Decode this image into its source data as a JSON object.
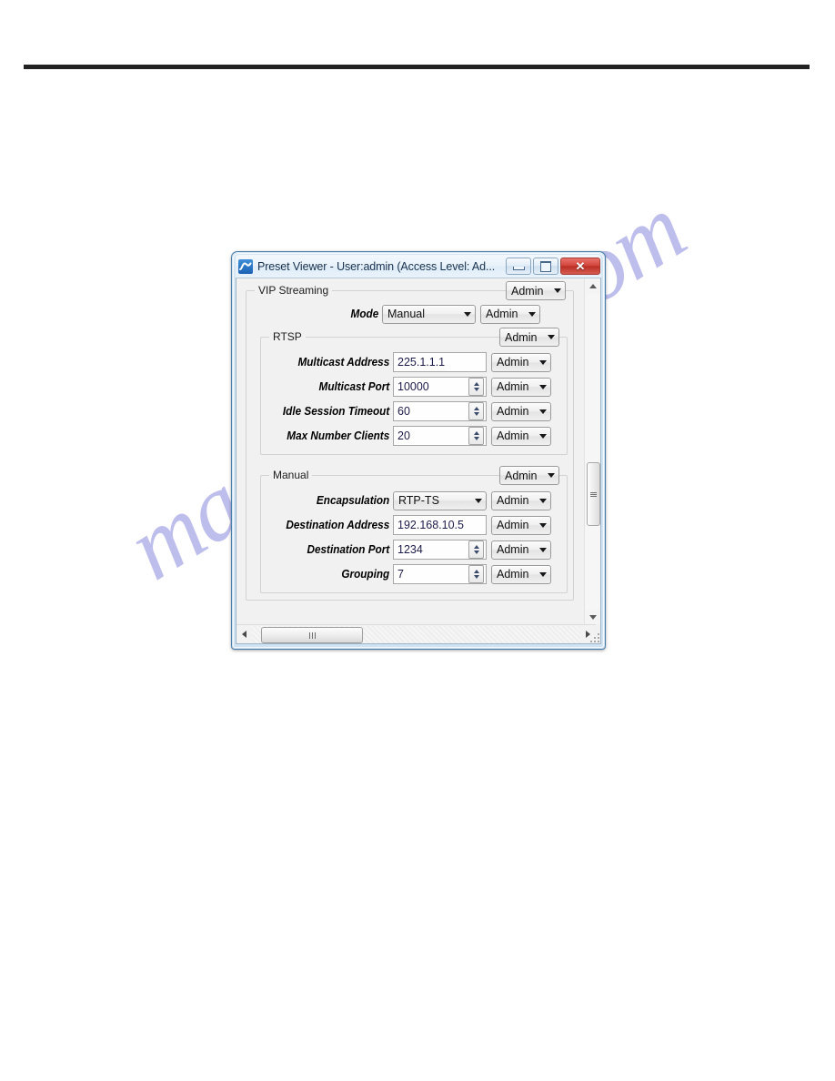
{
  "window": {
    "title": "Preset Viewer - User:admin (Access Level: Ad...",
    "icon": "wave-icon",
    "buttons": {
      "minimize": "minimize-button",
      "maximize": "maximize-button",
      "close": "close-button",
      "close_glyph": "✕"
    }
  },
  "groups": [
    {
      "label": "VIP Streaming",
      "permission": "Admin",
      "rows": [
        {
          "label": "Mode",
          "type": "combo",
          "value": "Manual",
          "permission": "Admin"
        }
      ]
    },
    {
      "label": "RTSP",
      "permission": "Admin",
      "rows": [
        {
          "label": "Multicast Address",
          "type": "text",
          "value": "225.1.1.1",
          "permission": "Admin"
        },
        {
          "label": "Multicast Port",
          "type": "spin",
          "value": "10000",
          "permission": "Admin"
        },
        {
          "label": "Idle Session Timeout",
          "type": "spin",
          "value": "60",
          "permission": "Admin"
        },
        {
          "label": "Max Number Clients",
          "type": "spin",
          "value": "20",
          "permission": "Admin"
        }
      ]
    },
    {
      "label": "Manual",
      "permission": "Admin",
      "rows": [
        {
          "label": "Encapsulation",
          "type": "combo",
          "value": "RTP-TS",
          "permission": "Admin"
        },
        {
          "label": "Destination Address",
          "type": "text",
          "value": "192.168.10.5",
          "permission": "Admin"
        },
        {
          "label": "Destination Port",
          "type": "spin",
          "value": "1234",
          "permission": "Admin"
        },
        {
          "label": "Grouping",
          "type": "spin",
          "value": "7",
          "permission": "Admin"
        }
      ]
    }
  ],
  "scrollbars": {
    "vertical": {
      "up": "scroll-up-arrow",
      "down": "scroll-down-arrow"
    },
    "horizontal": {
      "left": "scroll-left-arrow",
      "right": "scroll-right-arrow"
    }
  },
  "page": {
    "watermark": "manualshive.com",
    "watermark_color": "#b3b3ea"
  }
}
